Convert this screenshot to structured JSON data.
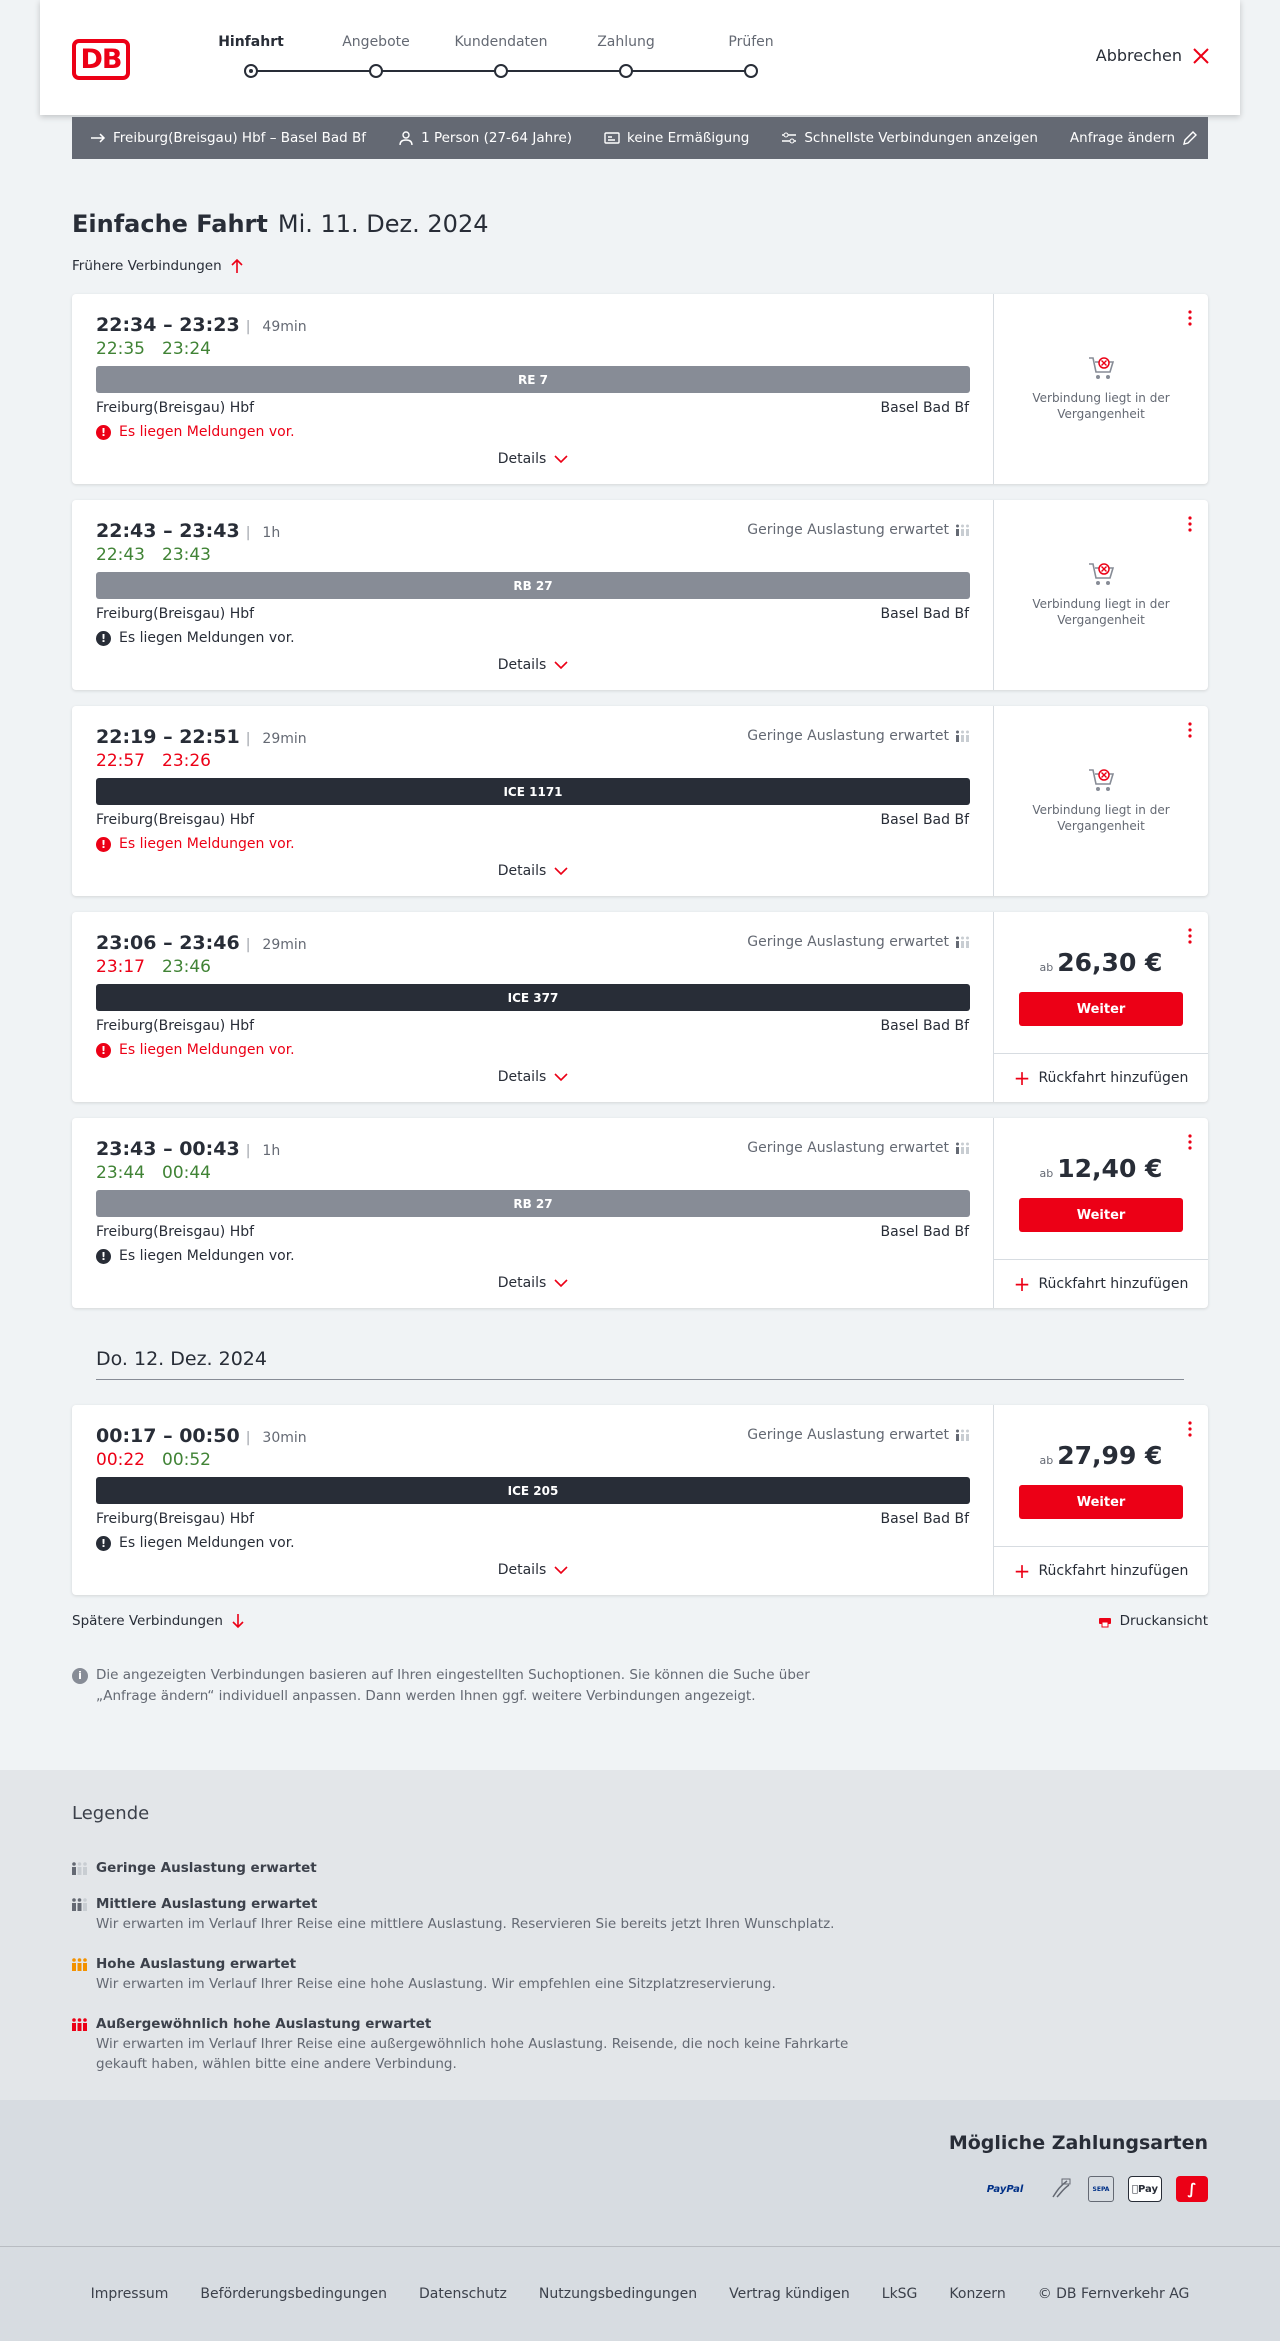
{
  "header": {
    "logo": "DB",
    "steps": [
      {
        "label": "Hinfahrt",
        "active": true
      },
      {
        "label": "Angebote",
        "active": false
      },
      {
        "label": "Kundendaten",
        "active": false
      },
      {
        "label": "Zahlung",
        "active": false
      },
      {
        "label": "Prüfen",
        "active": false
      }
    ],
    "cancel": "Abbrechen"
  },
  "query": {
    "route": "Freiburg(Breisgau) Hbf – Basel Bad Bf",
    "persons": "1 Person (27-64 Jahre)",
    "discount": "keine Ermäßigung",
    "fastest": "Schnellste Verbindungen anzeigen",
    "change": "Anfrage ändern"
  },
  "page": {
    "title": "Einfache Fahrt",
    "date": "Mi. 11. Dez. 2024",
    "earlier": "Frühere Verbindungen",
    "later": "Spätere Verbindungen",
    "print": "Druckansicht",
    "day2": "Do. 12. Dez. 2024",
    "note": "Die angezeigten Verbindungen basieren auf Ihren eingestellten Suchoptionen. Sie können die Suche über „Anfrage ändern“ individuell anpassen. Dann werden Ihnen ggf. weitere Verbindungen angezeigt."
  },
  "labels": {
    "details": "Details",
    "past": "Verbindung liegt in der Vergangenheit",
    "ab": "ab",
    "weiter": "Weiter",
    "return": "Rückfahrt hinzufügen"
  },
  "connections": [
    {
      "times": "22:34 – 23:23",
      "duration": "49min",
      "dep_rt": "22:35",
      "arr_rt": "23:24",
      "dep_rt_color": "green",
      "arr_rt_color": "green",
      "load": "",
      "train": "RE 7",
      "train_style": "reg",
      "from": "Freiburg(Breisgau) Hbf",
      "to": "Basel Bad Bf",
      "message": "Es liegen Meldungen vor.",
      "message_style": "warn",
      "past": true,
      "price": ""
    },
    {
      "times": "22:43 – 23:43",
      "duration": "1h",
      "dep_rt": "22:43",
      "arr_rt": "23:43",
      "dep_rt_color": "green",
      "arr_rt_color": "green",
      "load": "Geringe Auslastung erwartet",
      "train": "RB 27",
      "train_style": "reg",
      "from": "Freiburg(Breisgau) Hbf",
      "to": "Basel Bad Bf",
      "message": "Es liegen Meldungen vor.",
      "message_style": "info",
      "past": true,
      "price": ""
    },
    {
      "times": "22:19 – 22:51",
      "duration": "29min",
      "dep_rt": "22:57",
      "arr_rt": "23:26",
      "dep_rt_color": "red",
      "arr_rt_color": "red",
      "load": "Geringe Auslastung erwartet",
      "train": "ICE 1171",
      "train_style": "ice",
      "from": "Freiburg(Breisgau) Hbf",
      "to": "Basel Bad Bf",
      "message": "Es liegen Meldungen vor.",
      "message_style": "warn",
      "past": true,
      "price": ""
    },
    {
      "times": "23:06 – 23:46",
      "duration": "29min",
      "dep_rt": "23:17",
      "arr_rt": "23:46",
      "dep_rt_color": "red",
      "arr_rt_color": "green",
      "load": "Geringe Auslastung erwartet",
      "train": "ICE 377",
      "train_style": "ice",
      "from": "Freiburg(Breisgau) Hbf",
      "to": "Basel Bad Bf",
      "message": "Es liegen Meldungen vor.",
      "message_style": "warn",
      "past": false,
      "price": "26,30 €"
    },
    {
      "times": "23:43 – 00:43",
      "duration": "1h",
      "dep_rt": "23:44",
      "arr_rt": "00:44",
      "dep_rt_color": "green",
      "arr_rt_color": "green",
      "load": "Geringe Auslastung erwartet",
      "train": "RB 27",
      "train_style": "reg",
      "from": "Freiburg(Breisgau) Hbf",
      "to": "Basel Bad Bf",
      "message": "Es liegen Meldungen vor.",
      "message_style": "info",
      "past": false,
      "price": "12,40 €"
    },
    {
      "times": "00:17 – 00:50",
      "duration": "30min",
      "dep_rt": "00:22",
      "arr_rt": "00:52",
      "dep_rt_color": "red",
      "arr_rt_color": "green",
      "load": "Geringe Auslastung erwartet",
      "train": "ICE 205",
      "train_style": "ice",
      "from": "Freiburg(Breisgau) Hbf",
      "to": "Basel Bad Bf",
      "message": "Es liegen Meldungen vor.",
      "message_style": "info",
      "past": false,
      "price": "27,99 €"
    }
  ],
  "legend": {
    "title": "Legende",
    "items": [
      {
        "title": "Geringe Auslastung erwartet",
        "text": "",
        "color": "#646973",
        "level": 1
      },
      {
        "title": "Mittlere Auslastung erwartet",
        "text": "Wir erwarten im Verlauf Ihrer Reise eine mittlere Auslastung. Reservieren Sie bereits jetzt Ihren Wunschplatz.",
        "color": "#646973",
        "level": 2
      },
      {
        "title": "Hohe Auslastung erwartet",
        "text": "Wir erwarten im Verlauf Ihrer Reise eine hohe Auslastung. Wir empfehlen eine Sitzplatzreservierung.",
        "color": "#f39200",
        "level": 3
      },
      {
        "title": "Außergewöhnlich hohe Auslastung erwartet",
        "text": "Wir erwarten im Verlauf Ihrer Reise eine außergewöhnlich hohe Auslastung. Reisende, die noch keine Fahrkarte gekauft haben, wählen bitte eine andere Verbindung.",
        "color": "#ec0016",
        "level": 4
      }
    ]
  },
  "payment": {
    "title": "Mögliche Zahlungsarten",
    "methods": [
      "PayPal",
      "Kreditkarte",
      "SEPA",
      "Pay",
      "Sofort"
    ]
  },
  "footer": {
    "links": [
      "Impressum",
      "Beförderungsbedingungen",
      "Datenschutz",
      "Nutzungsbedingungen",
      "Vertrag kündigen",
      "LkSG",
      "Konzern",
      "© DB Fernverkehr AG"
    ]
  }
}
